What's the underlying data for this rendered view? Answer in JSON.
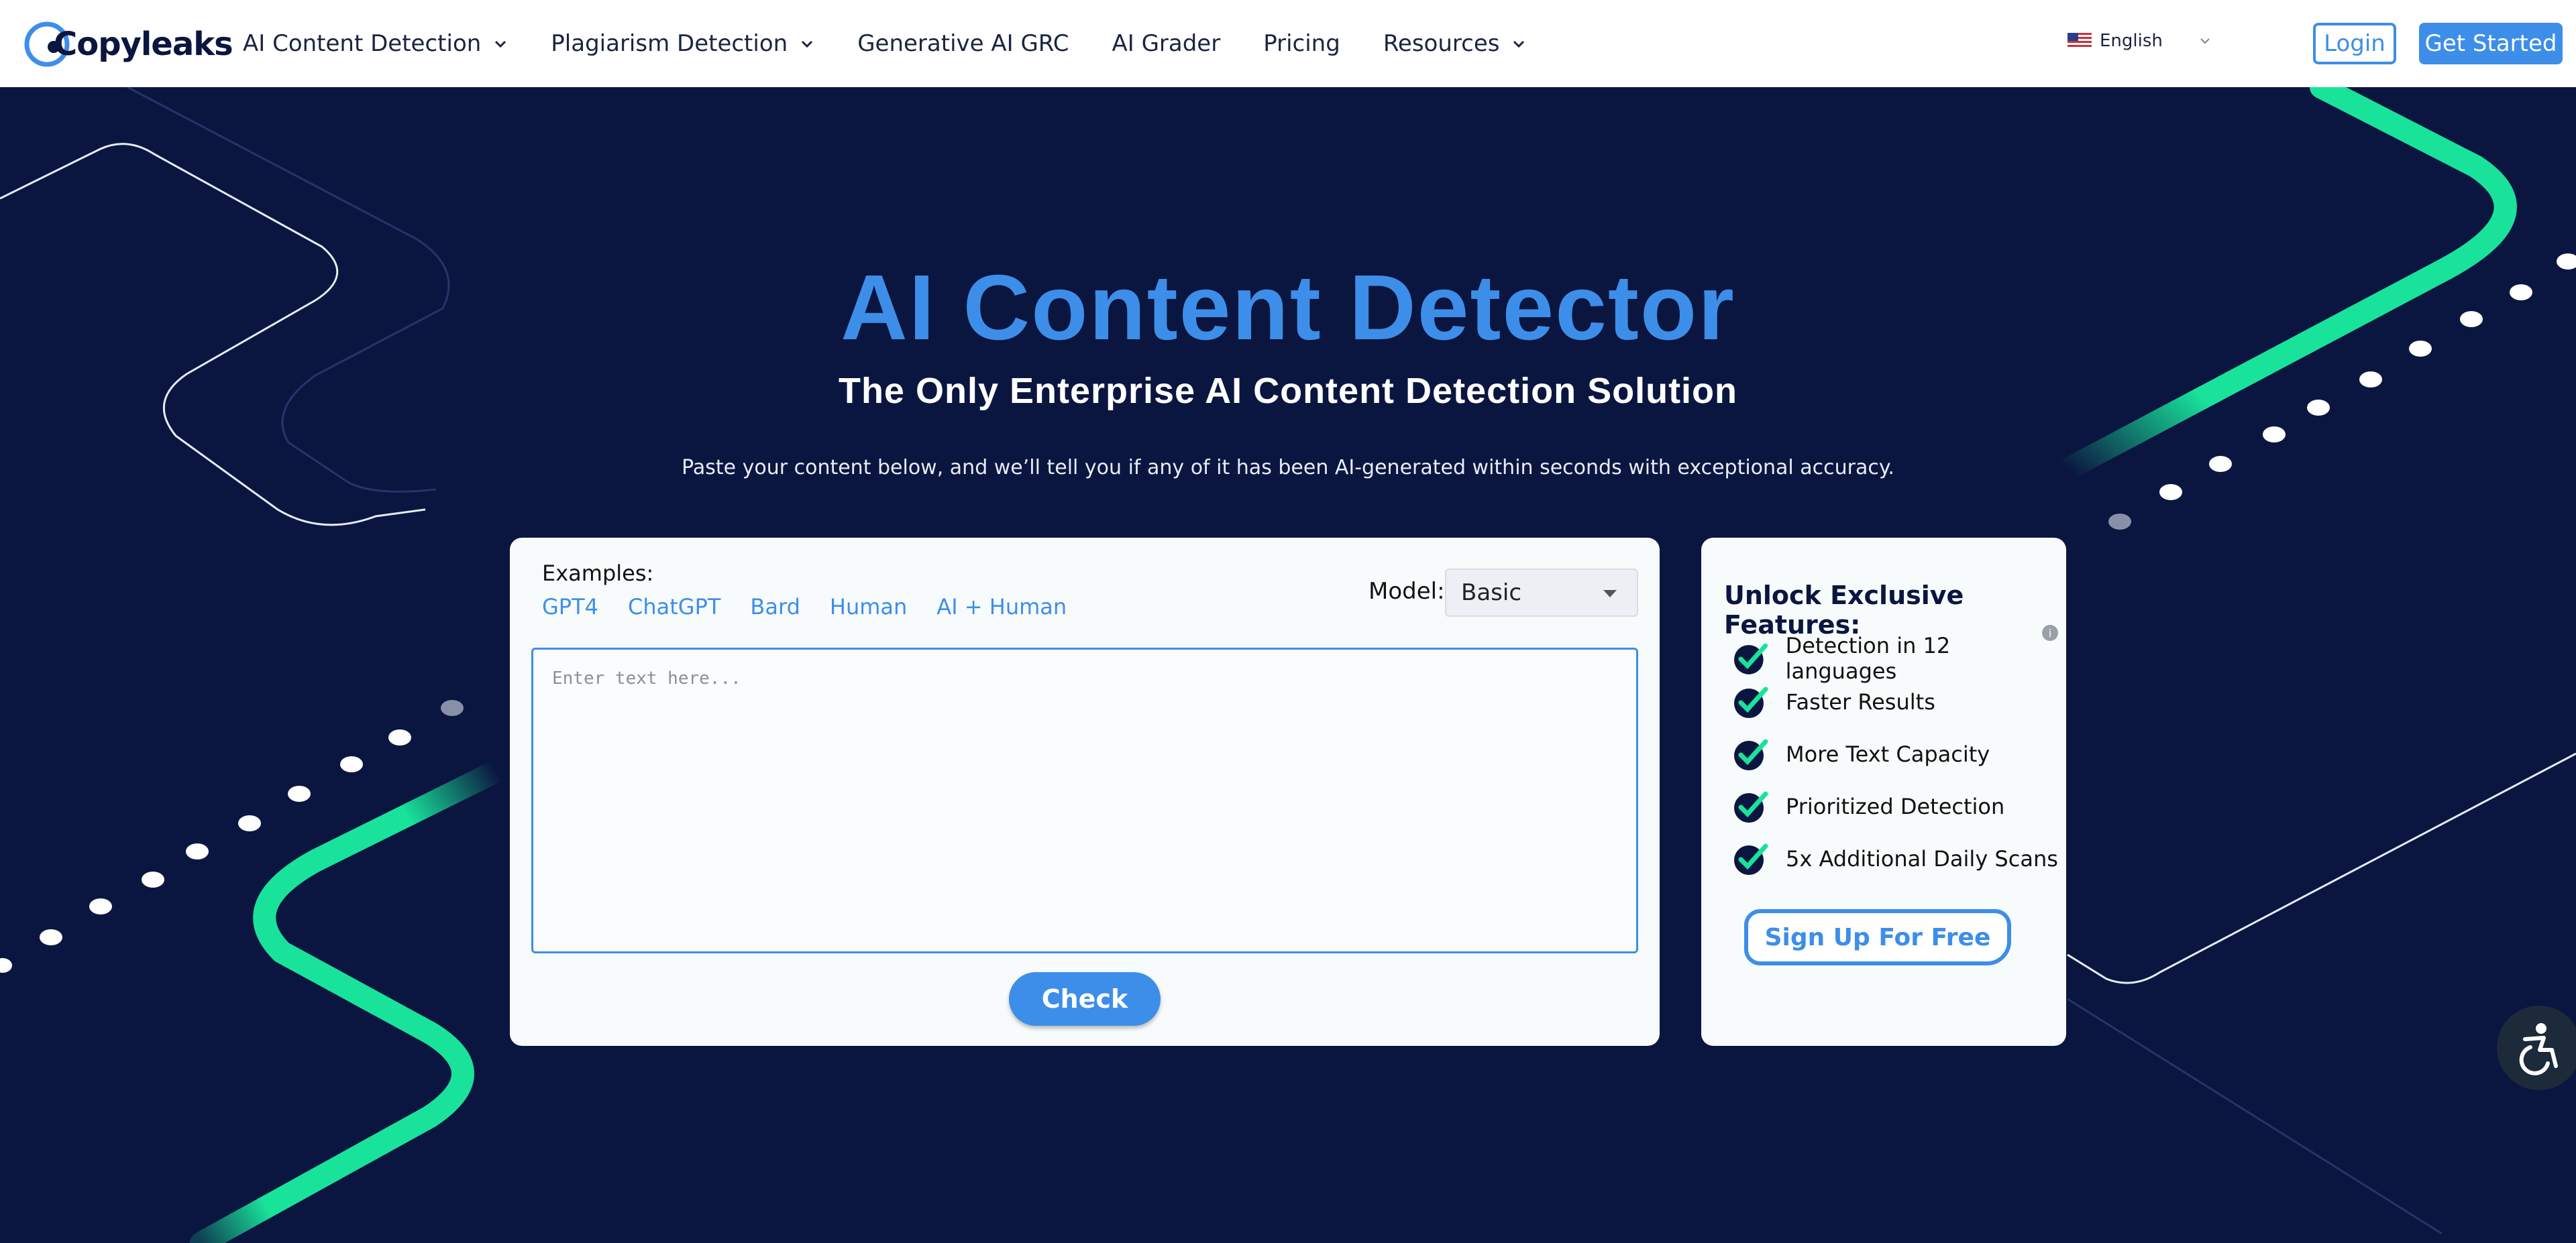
{
  "brand": {
    "name": "Copyleaks",
    "accent": "#3d8ee8",
    "navy": "#0b1640",
    "green": "#19e39b"
  },
  "header": {
    "nav": [
      {
        "label": "AI Content Detection",
        "dropdown": true
      },
      {
        "label": "Plagiarism Detection",
        "dropdown": true
      },
      {
        "label": "Generative AI GRC",
        "dropdown": false
      },
      {
        "label": "AI Grader",
        "dropdown": false
      },
      {
        "label": "Pricing",
        "dropdown": false
      },
      {
        "label": "Resources",
        "dropdown": true
      }
    ],
    "language": "English",
    "login_label": "Login",
    "get_started_label": "Get Started"
  },
  "hero": {
    "title": "AI Content Detector",
    "subtitle": "The Only Enterprise AI Content Detection Solution",
    "description": "Paste your content below, and we’ll tell you if any of it has been AI-generated within seconds with exceptional accuracy."
  },
  "detector": {
    "examples_label": "Examples:",
    "examples": [
      "GPT4",
      "ChatGPT",
      "Bard",
      "Human",
      "AI + Human"
    ],
    "model_label": "Model:",
    "model_value": "Basic",
    "input_placeholder": "Enter text here...",
    "input_value": "",
    "check_label": "Check"
  },
  "features": {
    "title": "Unlock Exclusive Features:",
    "items": [
      "Detection in 12 languages",
      "Faster Results",
      "More Text Capacity",
      "Prioritized Detection",
      "5x Additional Daily Scans"
    ],
    "info_icon": "i",
    "signup_label": "Sign Up For Free"
  }
}
